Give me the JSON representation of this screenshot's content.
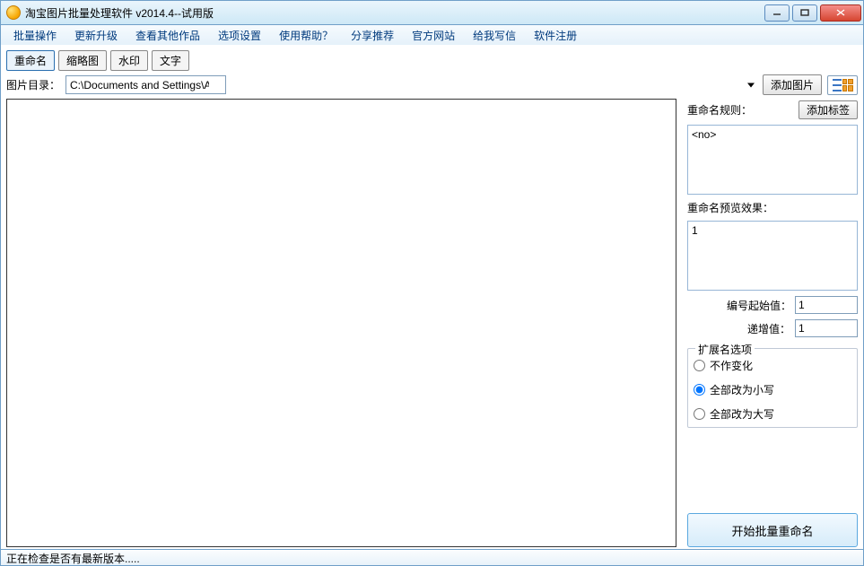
{
  "window": {
    "title": "淘宝图片批量处理软件 v2014.4--试用版"
  },
  "menu": {
    "items": [
      "批量操作",
      "更新升级",
      "查看其他作品",
      "选项设置",
      "使用帮助？",
      "分享推荐",
      "官方网站",
      "给我写信",
      "软件注册"
    ]
  },
  "tabs": {
    "t0": "重命名",
    "t1": "缩略图",
    "t2": "水印",
    "t3": "文字"
  },
  "path": {
    "label": "图片目录：",
    "value": "C:\\Documents and Settings\\All Users\\Documents\\My Pictures\\",
    "add": "添加图片"
  },
  "side": {
    "rules_label": "重命名规则：",
    "add_tag": "添加标签",
    "rule_text": "<no>",
    "preview_label": "重命名预览效果：",
    "preview_text": "1",
    "start_label": "编号起始值：",
    "start_value": "1",
    "incr_label": "递增值：",
    "incr_value": "1",
    "group_legend": "扩展名选项",
    "radio_nochange": "不作变化",
    "radio_lower": "全部改为小写",
    "radio_upper": "全部改为大写",
    "start_btn": "开始批量重命名"
  },
  "status": "正在检查是否有最新版本....."
}
